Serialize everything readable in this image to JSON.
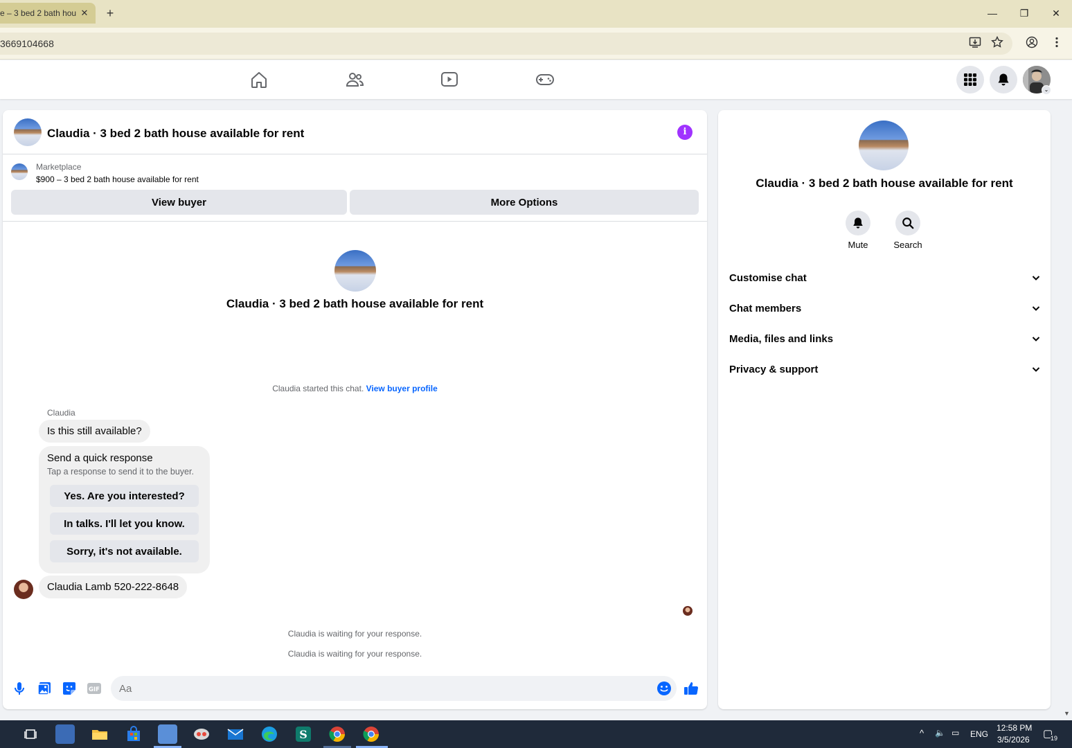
{
  "browser": {
    "tab_title": "e – 3 bed 2 bath hou",
    "tab_close": "✕",
    "new_tab": "+",
    "url": "3669104668",
    "window_controls": [
      "—",
      "❐",
      "✕"
    ]
  },
  "fbnav": {
    "icons": [
      "home-icon",
      "friends-icon",
      "video-icon",
      "gaming-icon"
    ]
  },
  "chat": {
    "header_title": "Claudia · 3 bed 2 bath house available for rent",
    "info_glyph": "i",
    "marketplace_label": "Marketplace",
    "listing": "$900 – 3 bed 2 bath house available for rent",
    "view_buyer": "View buyer",
    "more_options": "More Options",
    "center_title": "Claudia · 3 bed 2 bath house available for rent",
    "started_text": "Claudia started this chat.",
    "view_buyer_profile": "View buyer profile",
    "sender_name": "Claudia",
    "message_1": "Is this still available?",
    "quick_response_title": "Send a quick response",
    "quick_response_sub": "Tap a response to send it to the buyer.",
    "quick_responses": [
      "Yes. Are you interested?",
      "In talks. I'll let you know.",
      "Sorry, it's not available."
    ],
    "message_2": "Claudia Lamb 520-222-8648",
    "waiting_1": "Claudia is waiting for your response.",
    "waiting_2": "Claudia is waiting for your response.",
    "composer_placeholder": "Aa"
  },
  "right_panel": {
    "title": "Claudia · 3 bed 2 bath house available for rent",
    "mute": "Mute",
    "search": "Search",
    "sections": [
      "Customise chat",
      "Chat members",
      "Media, files and links",
      "Privacy & support"
    ]
  },
  "taskbar": {
    "lang": "ENG",
    "time": "12:58 PM",
    "date": "3/5/2026",
    "notif_count": "19"
  },
  "colors": {
    "accent": "#0866ff",
    "info": "#a033ff",
    "chrome_tab": "#e8e3c4"
  }
}
